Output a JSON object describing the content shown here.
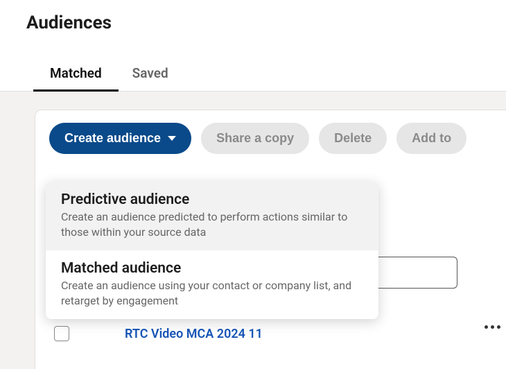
{
  "page": {
    "title": "Audiences"
  },
  "tabs": {
    "matched": "Matched",
    "saved": "Saved"
  },
  "toolbar": {
    "create": "Create audience",
    "share": "Share a copy",
    "delete": "Delete",
    "addto": "Add to"
  },
  "dropdown": {
    "predictive": {
      "title": "Predictive audience",
      "desc": "Create an audience predicted to perform actions similar to those within your source data"
    },
    "matched": {
      "title": "Matched audience",
      "desc": "Create an audience using your contact or company list, and retarget by engagement"
    }
  },
  "row": {
    "name": "RTC Video MCA 2024 11"
  }
}
